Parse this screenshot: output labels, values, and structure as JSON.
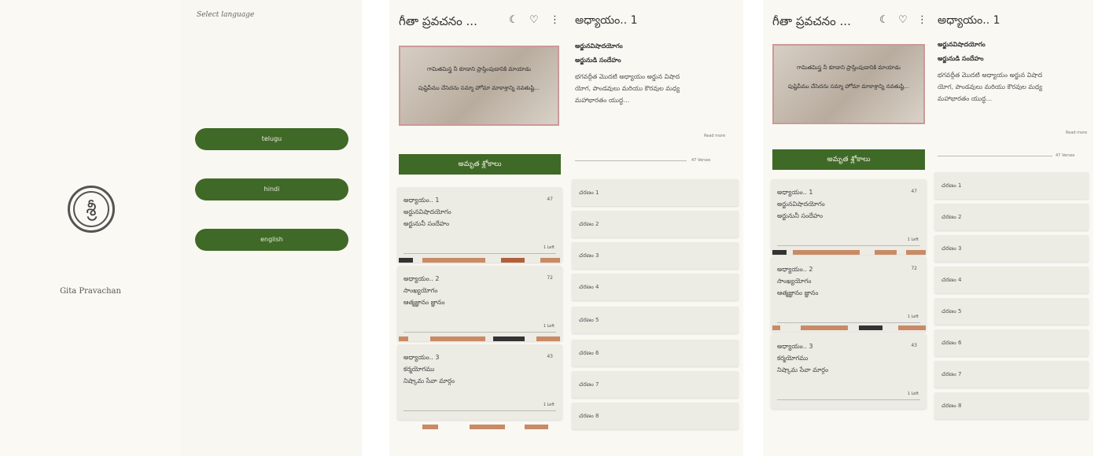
{
  "splash": {
    "logo_glyph": "శ్రీ",
    "app_name": "Gita Pravachan"
  },
  "language_screen": {
    "title": "Select language",
    "buttons": [
      "telugu",
      "hindi",
      "english"
    ]
  },
  "topbar": {
    "title": "గీతా ప్రవచనం ...",
    "icons": [
      "moon-icon",
      "heart-icon",
      "more-icon"
    ]
  },
  "hero": {
    "line1": "గామితమిస్త్ర నీ కూడాని ప్రాప్తింపుడానికి మాయాడు",
    "line2": "పుష్టిపీము చేసెదను సమ్మా హోమా మాకాశ్రాన్ని నవతుష్టి..."
  },
  "read_button": "అమృత శ్లోకాలు",
  "chapters": [
    {
      "label": "అధ్యాయం.. 1",
      "name": "అర్జునవిషాదయోగం",
      "desc": "అర్జునునీ సందేహం",
      "num": "47",
      "foot": "1 Left"
    },
    {
      "label": "అధ్యాయం.. 2",
      "name": "సాంఖ్యయోగం",
      "desc": "ఆత్మజ్ఞానం జ్ఞానం",
      "num": "72",
      "foot": "1 Left"
    },
    {
      "label": "అధ్యాయం.. 3",
      "name": "కర్మయోగము",
      "desc": "నిష్కామ సేవా మార్గం",
      "num": "43",
      "foot": "1 Left"
    }
  ],
  "chapter_detail": {
    "title": "అధ్యాయం.. 1",
    "yoga": "అర్జునవిషాదయోగం",
    "subtitle": "అర్జునుడి సందేహం",
    "summary_lines": [
      "భగవద్గీత మొదటి అధ్యాయం అర్జున విషాద",
      "యోగ, పాండవులు మరియు కౌరవుల మధ్య",
      "మహాభారతం యుద్ధ..."
    ],
    "read_more": "Read more",
    "verse_count_label": "47 Verses",
    "verses": [
      "చరణం 1",
      "చరణం 2",
      "చరణం 3",
      "చరణం 4",
      "చరణం 5",
      "చరణం 6",
      "చరణం 7",
      "చరణం 8"
    ]
  },
  "colors": {
    "accent": "#3f6926",
    "background": "#f9f8f3",
    "card": "#ecebe4"
  }
}
